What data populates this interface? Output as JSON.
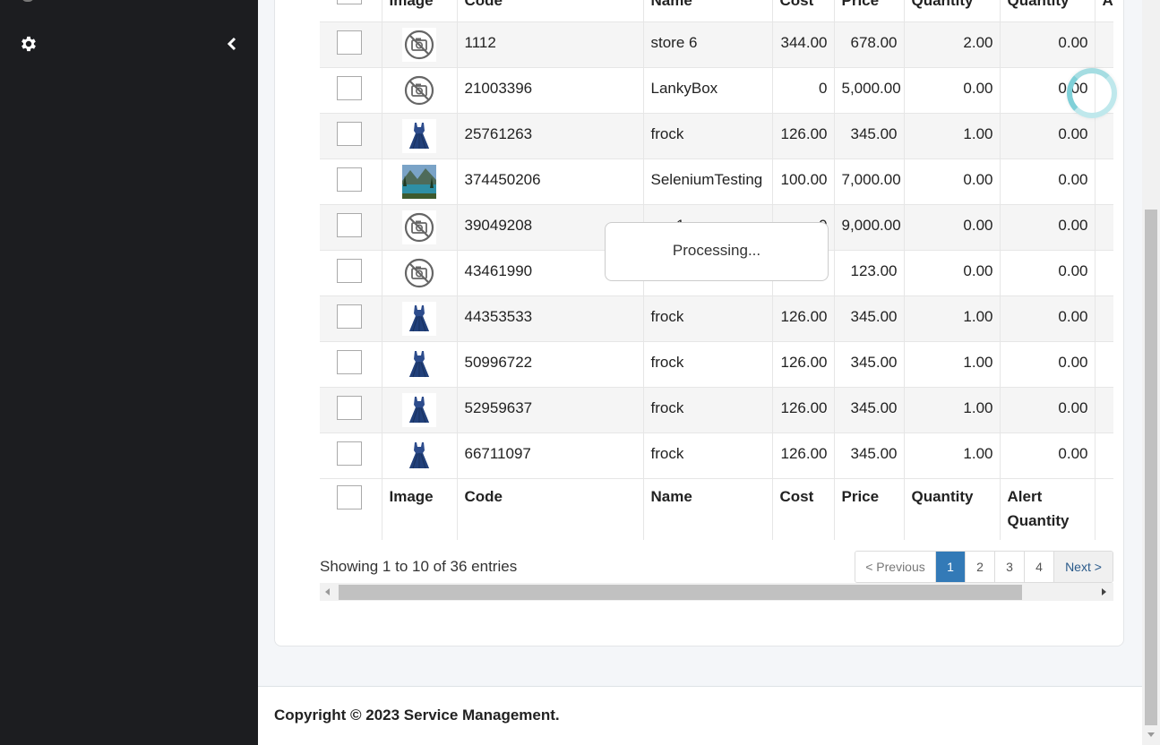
{
  "sidebar": {
    "items": [
      {
        "icon": "gear-icon"
      },
      {
        "icon": "chevron-left-icon"
      }
    ]
  },
  "table": {
    "headers": [
      "Image",
      "Code",
      "Name",
      "Cost",
      "Price",
      "Quantity",
      "Quantity",
      "A"
    ],
    "footer_headers": [
      "Image",
      "Code",
      "Name",
      "Cost",
      "Price",
      "Quantity",
      "Alert Quantity"
    ],
    "rows": [
      {
        "image": "no-image-icon",
        "code": "1112",
        "name": "store 6",
        "cost": "344.00",
        "price": "678.00",
        "quantity": "2.00",
        "alert_quantity": "0.00"
      },
      {
        "image": "no-image-icon",
        "code": "21003396",
        "name": "LankyBox",
        "cost": "0",
        "price": "5,000.00",
        "quantity": "0.00",
        "alert_quantity": "0.00"
      },
      {
        "image": "dress-thumbnail",
        "code": "25761263",
        "name": "frock",
        "cost": "126.00",
        "price": "345.00",
        "quantity": "1.00",
        "alert_quantity": "0.00"
      },
      {
        "image": "landscape-thumbnail",
        "code": "374450206",
        "name": "SeleniumTesting",
        "cost": "100.00",
        "price": "7,000.00",
        "quantity": "0.00",
        "alert_quantity": "0.00"
      },
      {
        "image": "no-image-icon",
        "code": "39049208",
        "name": "ppp1",
        "cost": "0",
        "price": "9,000.00",
        "quantity": "0.00",
        "alert_quantity": "0.00"
      },
      {
        "image": "no-image-icon",
        "code": "43461990",
        "name": "",
        "cost": "",
        "price": "123.00",
        "quantity": "0.00",
        "alert_quantity": "0.00"
      },
      {
        "image": "dress-thumbnail",
        "code": "44353533",
        "name": "frock",
        "cost": "126.00",
        "price": "345.00",
        "quantity": "1.00",
        "alert_quantity": "0.00"
      },
      {
        "image": "dress-thumbnail",
        "code": "50996722",
        "name": "frock",
        "cost": "126.00",
        "price": "345.00",
        "quantity": "1.00",
        "alert_quantity": "0.00"
      },
      {
        "image": "dress-thumbnail",
        "code": "52959637",
        "name": "frock",
        "cost": "126.00",
        "price": "345.00",
        "quantity": "1.00",
        "alert_quantity": "0.00"
      },
      {
        "image": "dress-thumbnail",
        "code": "66711097",
        "name": "frock",
        "cost": "126.00",
        "price": "345.00",
        "quantity": "1.00",
        "alert_quantity": "0.00"
      }
    ]
  },
  "info": "Showing 1 to 10 of 36 entries",
  "pagination": {
    "previous": "< Previous",
    "pages": [
      "1",
      "2",
      "3",
      "4"
    ],
    "active_page": "1",
    "next": "Next >"
  },
  "processing": "Processing...",
  "footer": {
    "copyright": "Copyright © 2023 Service Management."
  },
  "colors": {
    "sidebar_bg": "#1c1d20",
    "active_page": "#337ab7",
    "spinner": "#7fd0d8"
  }
}
